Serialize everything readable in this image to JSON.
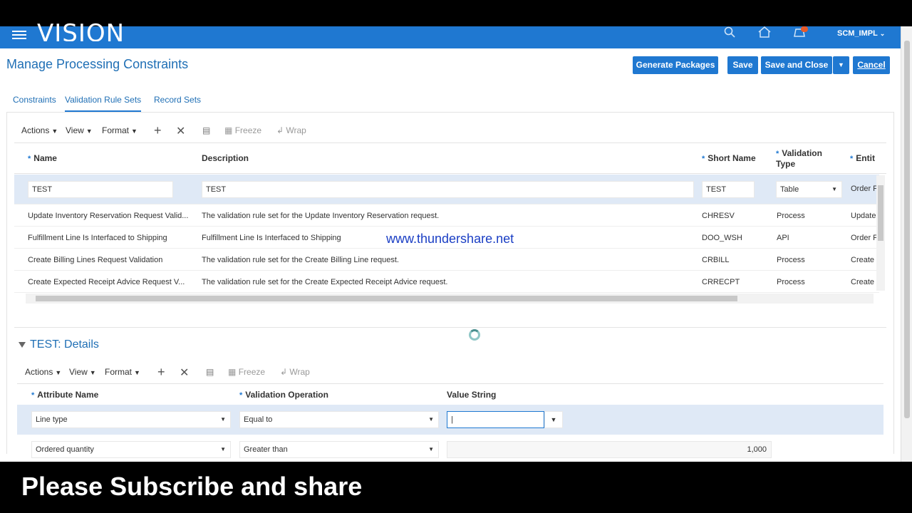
{
  "header": {
    "brand": "VISION",
    "user": "SCM_IMPL",
    "icons": [
      "menu-icon",
      "search-icon",
      "home-icon",
      "notifications-icon",
      "chevron-down-icon"
    ]
  },
  "page": {
    "title": "Manage Processing Constraints"
  },
  "buttons": {
    "generate": "Generate Packages",
    "save": "Save",
    "save_close": "Save and Close",
    "cancel": "Cancel"
  },
  "tabs": [
    "Constraints",
    "Validation Rule Sets",
    "Record Sets"
  ],
  "toolbar": {
    "actions": "Actions",
    "view": "View",
    "format": "Format",
    "freeze": "Freeze",
    "wrap": "Wrap"
  },
  "grid": {
    "headers": {
      "name": "Name",
      "description": "Description",
      "short_name": "Short Name",
      "validation_type_1": "Validation",
      "validation_type_2": "Type",
      "entity": "Entit"
    },
    "selected_row": {
      "name": "TEST",
      "description": "TEST",
      "short_name": "TEST",
      "validation_type": "Table",
      "entity": "Order F"
    },
    "rows": [
      {
        "name": "Update Inventory Reservation Request Valid...",
        "description": "The validation rule set for the Update Inventory Reservation request.",
        "short_name": "CHRESV",
        "type": "Process",
        "entity": "Update"
      },
      {
        "name": "Fulfillment Line Is Interfaced to Shipping",
        "description": "Fulfillment Line Is Interfaced to Shipping",
        "short_name": "DOO_WSH",
        "type": "API",
        "entity": "Order F"
      },
      {
        "name": "Create Billing Lines Request Validation",
        "description": "The validation rule set for the Create Billing Line request.",
        "short_name": "CRBILL",
        "type": "Process",
        "entity": "Create"
      },
      {
        "name": "Create Expected Receipt Advice Request V...",
        "description": "The validation rule set for the Create Expected Receipt Advice request.",
        "short_name": "CRRECPT",
        "type": "Process",
        "entity": "Create"
      }
    ]
  },
  "watermark": "www.thundershare.net",
  "details": {
    "title": "TEST: Details",
    "headers": {
      "attribute": "Attribute Name",
      "operation": "Validation Operation",
      "value": "Value String"
    },
    "rows": [
      {
        "attribute": "Line type",
        "operation": "Equal to",
        "value": "|"
      },
      {
        "attribute": "Ordered quantity",
        "operation": "Greater than",
        "value": "1,000"
      }
    ]
  },
  "overlay_text": "Please Subscribe and share"
}
